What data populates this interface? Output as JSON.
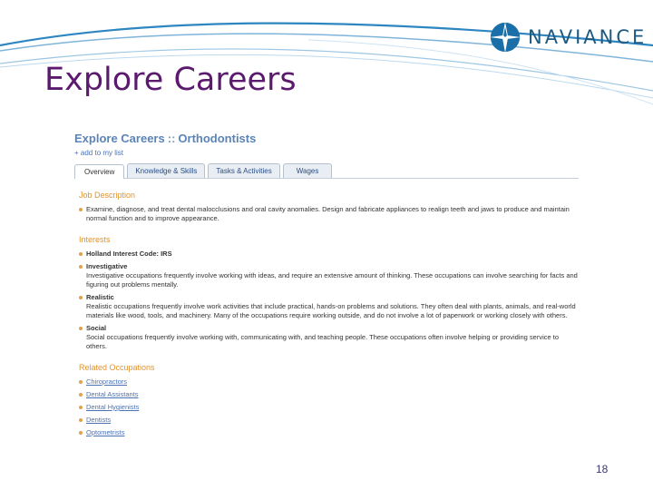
{
  "slide": {
    "title": "Explore Careers",
    "page_number": "18"
  },
  "logo": {
    "text": "NAVIANCE"
  },
  "breadcrumb": {
    "root": "Explore Careers",
    "separator": "::",
    "current": "Orthodontists"
  },
  "add_to_list": "+ add to my list",
  "tabs": [
    {
      "label": "Overview",
      "active": true
    },
    {
      "label": "Knowledge & Skills",
      "active": false
    },
    {
      "label": "Tasks & Activities",
      "active": false
    },
    {
      "label": "Wages",
      "active": false
    }
  ],
  "job_description": {
    "heading": "Job Description",
    "text": "Examine, diagnose, and treat dental malocclusions and oral cavity anomalies. Design and fabricate appliances to realign teeth and jaws to produce and maintain normal function and to improve appearance."
  },
  "interests": {
    "heading": "Interests",
    "holland_code": "Holland Interest Code: IRS",
    "items": [
      {
        "title": "Investigative",
        "text": "Investigative occupations frequently involve working with ideas, and require an extensive amount of thinking. These occupations can involve searching for facts and figuring out problems mentally."
      },
      {
        "title": "Realistic",
        "text": "Realistic occupations frequently involve work activities that include practical, hands-on problems and solutions. They often deal with plants, animals, and real-world materials like wood, tools, and machinery. Many of the occupations require working outside, and do not involve a lot of paperwork or working closely with others."
      },
      {
        "title": "Social",
        "text": "Social occupations frequently involve working with, communicating with, and teaching people. These occupations often involve helping or providing service to others."
      }
    ]
  },
  "related": {
    "heading": "Related Occupations",
    "items": [
      "Chiropractors",
      "Dental Assistants",
      "Dental Hygienists",
      "Dentists",
      "Optometrists"
    ]
  },
  "colors": {
    "title": "#5b1a6e",
    "section_heading": "#e0932e",
    "link": "#4b72b4",
    "swoosh": "#2e7fb8"
  }
}
